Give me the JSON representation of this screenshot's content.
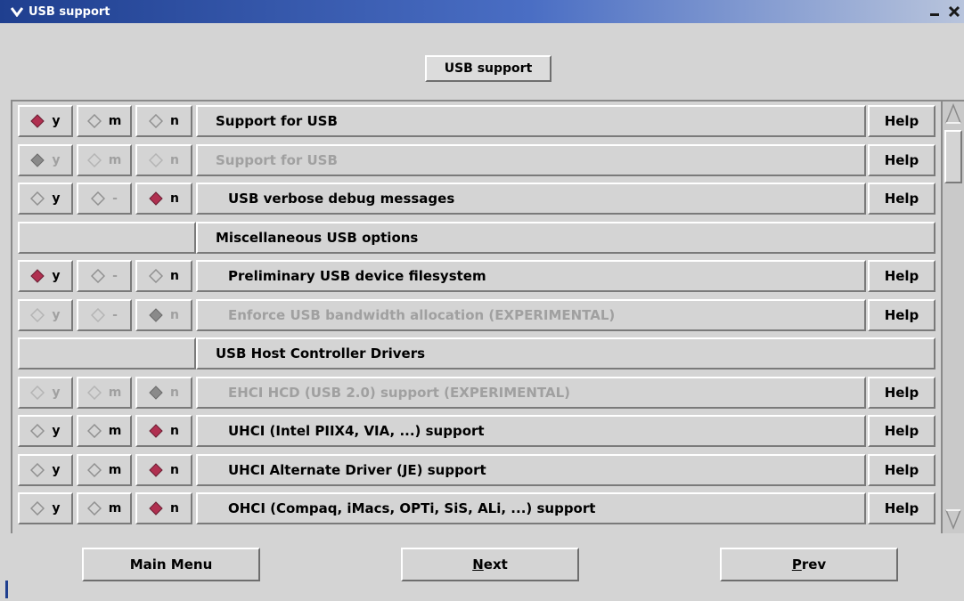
{
  "window": {
    "title": "USB support"
  },
  "header": {
    "button_label": "USB support"
  },
  "colors": {
    "selected_radio": "#b03050",
    "title_bar": "#1f3f8f"
  },
  "rows": [
    {
      "type": "option",
      "label": "Support for USB",
      "y": "y",
      "m": "m",
      "n": "n",
      "selected": "y",
      "enabled": true,
      "help": "Help",
      "indent": false
    },
    {
      "type": "option",
      "label": "Support for USB",
      "y": "y",
      "m": "m",
      "n": "n",
      "selected": "y",
      "enabled": false,
      "help": "Help",
      "indent": false
    },
    {
      "type": "option",
      "label": "USB verbose debug messages",
      "y": "y",
      "m": "-",
      "n": "n",
      "selected": "n",
      "enabled": true,
      "help": "Help",
      "indent": true
    },
    {
      "type": "menu",
      "label": "Miscellaneous USB options"
    },
    {
      "type": "option",
      "label": "Preliminary USB device filesystem",
      "y": "y",
      "m": "-",
      "n": "n",
      "selected": "y",
      "enabled": true,
      "help": "Help",
      "indent": true
    },
    {
      "type": "option",
      "label": "Enforce USB bandwidth allocation (EXPERIMENTAL)",
      "y": "y",
      "m": "-",
      "n": "n",
      "selected": "n",
      "enabled": false,
      "help": "Help",
      "indent": true
    },
    {
      "type": "menu",
      "label": "USB Host Controller Drivers"
    },
    {
      "type": "option",
      "label": "EHCI HCD (USB 2.0) support (EXPERIMENTAL)",
      "y": "y",
      "m": "m",
      "n": "n",
      "selected": "n",
      "enabled": false,
      "help": "Help",
      "indent": true
    },
    {
      "type": "option",
      "label": "UHCI (Intel PIIX4, VIA, ...) support",
      "y": "y",
      "m": "m",
      "n": "n",
      "selected": "n",
      "enabled": true,
      "help": "Help",
      "indent": true
    },
    {
      "type": "option",
      "label": "UHCI Alternate Driver (JE) support",
      "y": "y",
      "m": "m",
      "n": "n",
      "selected": "n",
      "enabled": true,
      "help": "Help",
      "indent": true
    },
    {
      "type": "option",
      "label": "OHCI (Compaq, iMacs, OPTi, SiS, ALi, ...) support",
      "y": "y",
      "m": "m",
      "n": "n",
      "selected": "n",
      "enabled": true,
      "help": "Help",
      "indent": true
    }
  ],
  "footer": {
    "main_menu": "Main Menu",
    "next_first": "N",
    "next_rest": "ext",
    "prev_first": "P",
    "prev_rest": "rev"
  }
}
